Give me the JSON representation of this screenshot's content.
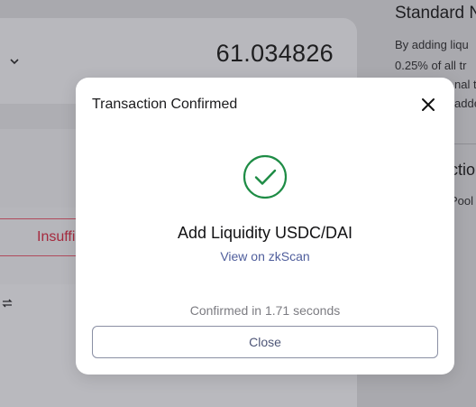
{
  "background": {
    "amount": "61.034826",
    "warning_button_label": "Insuffi",
    "right_title": "Standard N",
    "right_lines": [
      "By adding liqu",
      "0.25% of all tr",
      "nal t",
      "adde"
    ],
    "right_subtitle": "ctio",
    "right_small": "Pool"
  },
  "modal": {
    "title": "Transaction Confirmed",
    "action": "Add Liquidity USDC/DAI",
    "link": "View on zkScan",
    "confirmed_time": "Confirmed in 1.71 seconds",
    "close_button": "Close"
  },
  "colors": {
    "success": "#1e8c45",
    "link": "#4f5e9c",
    "warning": "#a52a3e"
  }
}
